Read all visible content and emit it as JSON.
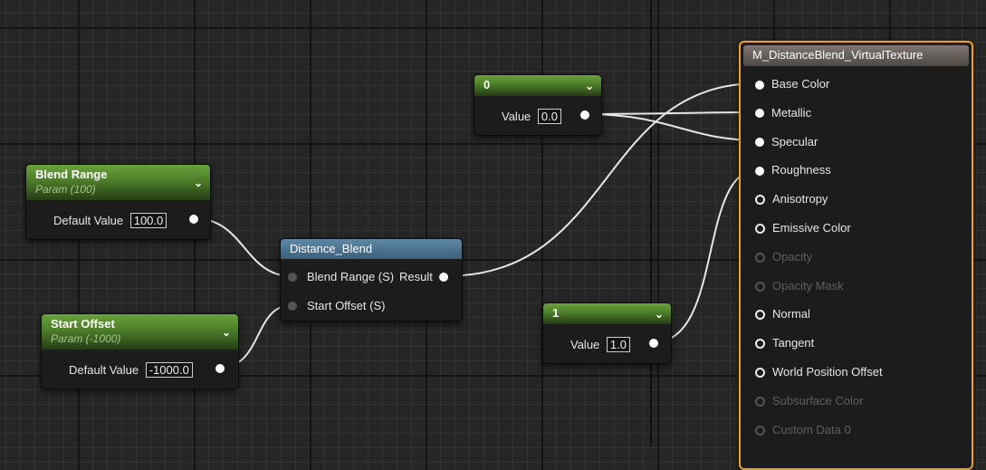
{
  "nodes": {
    "const0": {
      "title": "0",
      "value_label": "Value",
      "value": "0.0"
    },
    "const1": {
      "title": "1",
      "value_label": "Value",
      "value": "1.0"
    },
    "blend_range": {
      "title": "Blend Range",
      "subtitle": "Param (100)",
      "value_label": "Default Value",
      "value": "100.0"
    },
    "start_offset": {
      "title": "Start Offset",
      "subtitle": "Param (-1000)",
      "value_label": "Default Value",
      "value": "-1000.0"
    },
    "distance_blend": {
      "title": "Distance_Blend",
      "inputs": [
        "Blend Range (S)",
        "Start Offset (S)"
      ],
      "output": "Result"
    },
    "material": {
      "title": "M_DistanceBlend_VirtualTexture",
      "pins": [
        {
          "label": "Base Color",
          "state": "connected"
        },
        {
          "label": "Metallic",
          "state": "connected"
        },
        {
          "label": "Specular",
          "state": "connected"
        },
        {
          "label": "Roughness",
          "state": "connected"
        },
        {
          "label": "Anisotropy",
          "state": "open"
        },
        {
          "label": "Emissive Color",
          "state": "open"
        },
        {
          "label": "Opacity",
          "state": "disabled"
        },
        {
          "label": "Opacity Mask",
          "state": "disabled"
        },
        {
          "label": "Normal",
          "state": "open"
        },
        {
          "label": "Tangent",
          "state": "open"
        },
        {
          "label": "World Position Offset",
          "state": "open"
        },
        {
          "label": "Subsurface Color",
          "state": "disabled"
        },
        {
          "label": "Custom Data 0",
          "state": "disabled"
        }
      ]
    }
  },
  "colors": {
    "wire": "#e8e8e8",
    "selection": "#f0a020"
  }
}
